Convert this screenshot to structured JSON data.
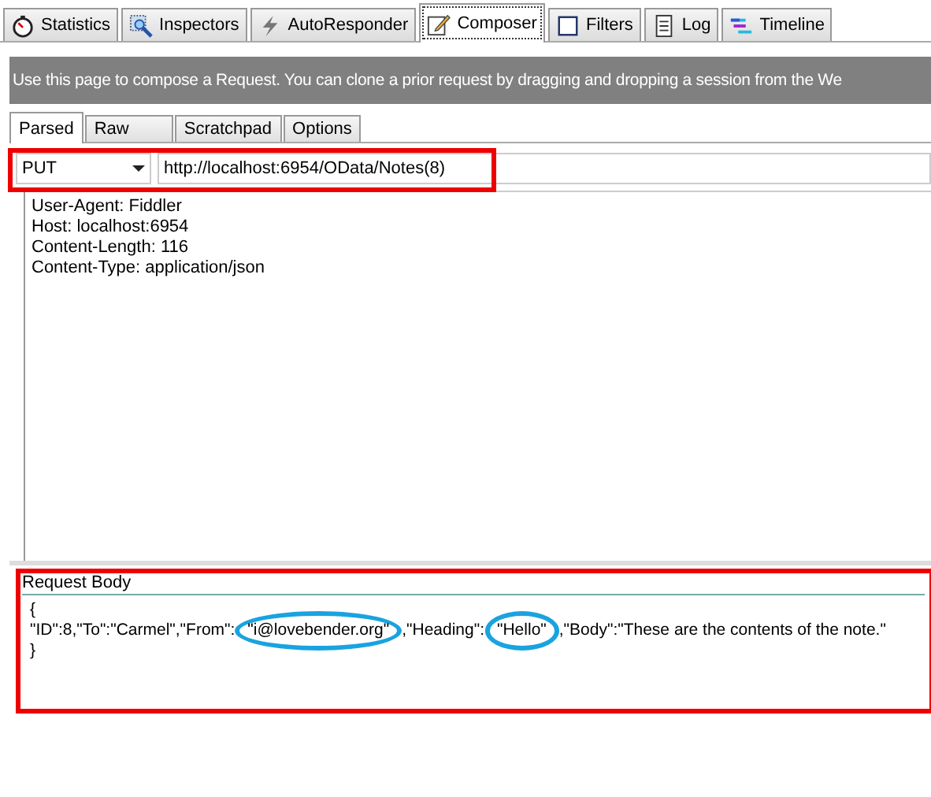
{
  "tabs": [
    {
      "label": "Statistics",
      "selected": false
    },
    {
      "label": "Inspectors",
      "selected": false
    },
    {
      "label": "AutoResponder",
      "selected": false
    },
    {
      "label": "Composer",
      "selected": true
    },
    {
      "label": "Filters",
      "selected": false
    },
    {
      "label": "Log",
      "selected": false
    },
    {
      "label": "Timeline",
      "selected": false
    }
  ],
  "banner": "Use this page to compose a Request. You can clone a prior request by  dragging and dropping a session from the We",
  "subtabs": [
    {
      "label": "Parsed",
      "selected": true
    },
    {
      "label": "Raw",
      "selected": false
    },
    {
      "label": "Scratchpad",
      "selected": false
    },
    {
      "label": "Options",
      "selected": false
    }
  ],
  "request": {
    "method": "PUT",
    "url": "http://localhost:6954/OData/Notes(8)"
  },
  "headers": [
    "User-Agent: Fiddler",
    "Host: localhost:6954",
    "Content-Length: 116",
    "Content-Type: application/json"
  ],
  "body": {
    "label": "Request Body",
    "lines": [
      {
        "segments": [
          {
            "text": "{",
            "circled": false
          }
        ]
      },
      {
        "segments": [
          {
            "text": "\"ID\":8,\"To\":\"Carmel\",\"From\":",
            "circled": false
          },
          {
            "text": "\"i@lovebender.org\"",
            "circled": true
          },
          {
            "text": ",\"Heading\":",
            "circled": false
          },
          {
            "text": "\"Hello\"",
            "circled": true
          },
          {
            "text": ",\"Body\":\"These are the contents of the note.\"",
            "circled": false
          }
        ]
      },
      {
        "segments": [
          {
            "text": "}",
            "circled": false
          }
        ]
      }
    ]
  }
}
